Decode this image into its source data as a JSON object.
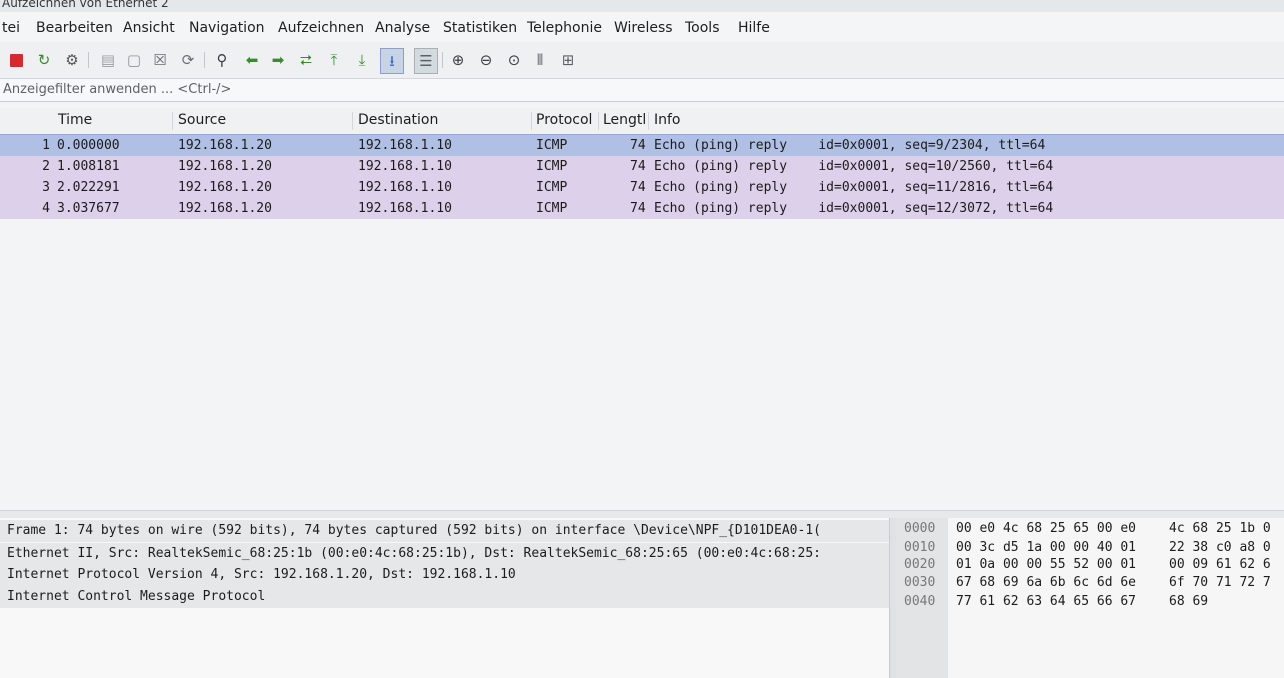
{
  "window": {
    "title": "Aufzeichnen von Ethernet 2"
  },
  "menu": [
    "tei",
    "Bearbeiten",
    "Ansicht",
    "Navigation",
    "Aufzeichnen",
    "Analyse",
    "Statistiken",
    "Telephonie",
    "Wireless",
    "Tools",
    "Hilfe"
  ],
  "toolbar": {
    "icons": [
      "stop-capture-icon",
      "restart-capture-icon",
      "capture-options-icon",
      "open-file-icon",
      "save-file-icon",
      "close-file-icon",
      "reload-file-icon",
      "find-packet-icon",
      "go-back-icon",
      "go-forward-icon",
      "go-to-packet-icon",
      "go-first-packet-icon",
      "go-last-packet-icon",
      "autoscroll-icon",
      "colorize-icon",
      "zoom-in-icon",
      "zoom-out-icon",
      "zoom-normal-icon",
      "resize-columns-icon",
      "layout-panes-icon"
    ]
  },
  "filter": {
    "placeholder": "Anzeigefilter anwenden ... <Ctrl-/>"
  },
  "colors": {
    "selected_row": "#b0c0e4",
    "icmp_row": "#ddd0ea",
    "stop_red": "#d62b2b"
  },
  "packet_list": {
    "columns": [
      "Time",
      "Source",
      "Destination",
      "Protocol",
      "Lengtl",
      "Info"
    ],
    "rows": [
      {
        "no": "1",
        "time": "0.000000",
        "source": "192.168.1.20",
        "destination": "192.168.1.10",
        "protocol": "ICMP",
        "length": "74",
        "info": "Echo (ping) reply    id=0x0001, seq=9/2304, ttl=64"
      },
      {
        "no": "2",
        "time": "1.008181",
        "source": "192.168.1.20",
        "destination": "192.168.1.10",
        "protocol": "ICMP",
        "length": "74",
        "info": "Echo (ping) reply    id=0x0001, seq=10/2560, ttl=64"
      },
      {
        "no": "3",
        "time": "2.022291",
        "source": "192.168.1.20",
        "destination": "192.168.1.10",
        "protocol": "ICMP",
        "length": "74",
        "info": "Echo (ping) reply    id=0x0001, seq=11/2816, ttl=64"
      },
      {
        "no": "4",
        "time": "3.037677",
        "source": "192.168.1.20",
        "destination": "192.168.1.10",
        "protocol": "ICMP",
        "length": "74",
        "info": "Echo (ping) reply    id=0x0001, seq=12/3072, ttl=64"
      }
    ]
  },
  "details": {
    "lines": [
      "Frame 1: 74 bytes on wire (592 bits), 74 bytes captured (592 bits) on interface \\Device\\NPF_{D101DEA0-1(",
      "Ethernet II, Src: RealtekSemic_68:25:1b (00:e0:4c:68:25:1b), Dst: RealtekSemic_68:25:65 (00:e0:4c:68:25:",
      "Internet Protocol Version 4, Src: 192.168.1.20, Dst: 192.168.1.10",
      "Internet Control Message Protocol"
    ]
  },
  "bytes": {
    "rows": [
      {
        "offset": "0000",
        "hex1": "00 e0 4c 68 25 65 00 e0",
        "hex2": "4c 68 25 1b 0"
      },
      {
        "offset": "0010",
        "hex1": "00 3c d5 1a 00 00 40 01",
        "hex2": "22 38 c0 a8 0"
      },
      {
        "offset": "0020",
        "hex1": "01 0a 00 00 55 52 00 01",
        "hex2": "00 09 61 62 6"
      },
      {
        "offset": "0030",
        "hex1": "67 68 69 6a 6b 6c 6d 6e",
        "hex2": "6f 70 71 72 7"
      },
      {
        "offset": "0040",
        "hex1": "77 61 62 63 64 65 66 67",
        "hex2": "68 69"
      }
    ]
  }
}
